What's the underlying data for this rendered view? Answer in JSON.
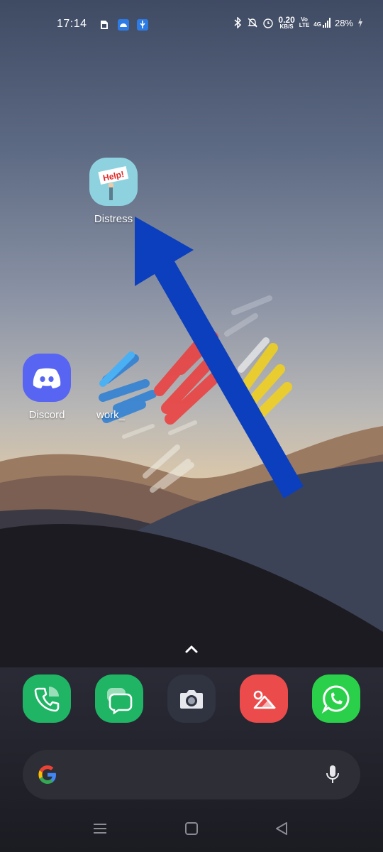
{
  "status_bar": {
    "time": "17:14",
    "notification_icons": [
      "sim-card-icon",
      "android-icon",
      "usb-icon"
    ],
    "system_icons": [
      "bluetooth-icon",
      "mute-icon",
      "alarm-icon"
    ],
    "net_speed": "0.20",
    "net_speed_unit": "KB/S",
    "volte_top": "Vo",
    "volte_bottom": "LTE",
    "network_type": "4G",
    "battery": "28%"
  },
  "home_apps": [
    {
      "label": "Distress",
      "icon": "help-sign-icon"
    },
    {
      "label": "Discord",
      "icon": "discord-icon"
    },
    {
      "label": "work_",
      "icon": "work-app-icon"
    }
  ],
  "dock": [
    {
      "icon": "phone-icon",
      "color": "#1fb565"
    },
    {
      "icon": "messages-icon",
      "color": "#1fb565"
    },
    {
      "icon": "camera-icon",
      "color": "#2f3440"
    },
    {
      "icon": "gallery-icon",
      "color": "#ec4b4b"
    },
    {
      "icon": "whatsapp-icon",
      "color": "#2ad04a"
    }
  ],
  "search": {
    "left_icon": "google-icon",
    "right_icon": "microphone-icon"
  },
  "nav": {
    "items": [
      "menu-icon",
      "home-icon",
      "back-icon"
    ]
  },
  "colors": {
    "arrow": "#0c3fbd",
    "discord": "#5865f2",
    "distress_bg": "#8fd2df"
  }
}
